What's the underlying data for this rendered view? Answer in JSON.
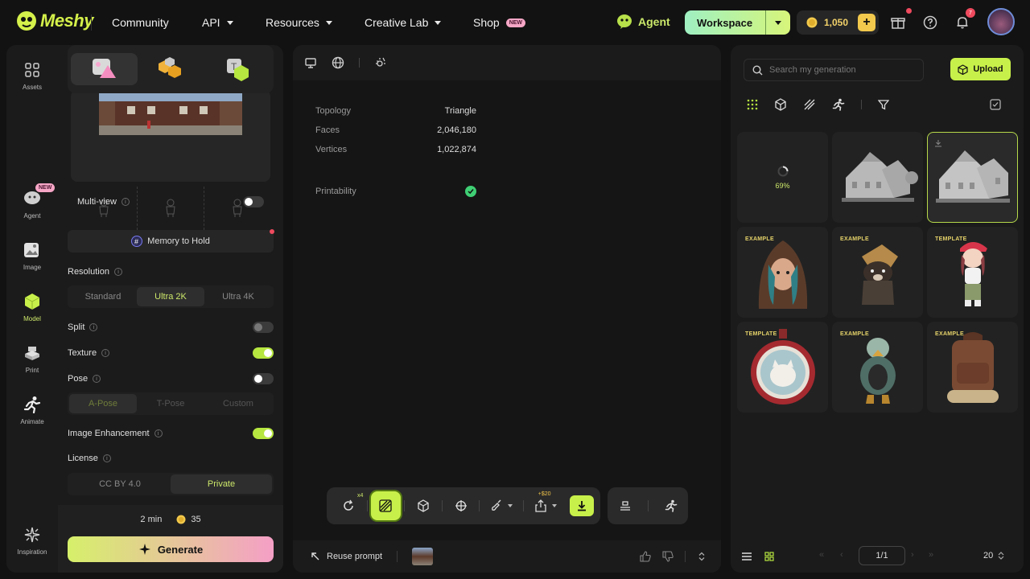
{
  "nav": {
    "logo_text": "Meshy",
    "items": [
      {
        "label": "Community",
        "dropdown": false
      },
      {
        "label": "API",
        "dropdown": true
      },
      {
        "label": "Resources",
        "dropdown": true
      },
      {
        "label": "Creative Lab",
        "dropdown": true
      },
      {
        "label": "Shop",
        "dropdown": false,
        "badge": "NEW"
      }
    ],
    "agent_label": "Agent",
    "workspace_label": "Workspace",
    "credits": "1,050",
    "notification_count": "7"
  },
  "rail": {
    "items": [
      {
        "label": "Assets",
        "icon": "grid-icon"
      },
      {
        "label": "Agent",
        "icon": "chat-bubble-icon",
        "badge": "NEW"
      },
      {
        "label": "Image",
        "icon": "image-plus-icon"
      },
      {
        "label": "Model",
        "icon": "cube-plus-icon",
        "active": true
      },
      {
        "label": "Print",
        "icon": "printer-icon"
      },
      {
        "label": "Animate",
        "icon": "running-figure-icon"
      },
      {
        "label": "Inspiration",
        "icon": "sparkle-icon"
      }
    ]
  },
  "settings": {
    "multiview_label": "Multi-view",
    "memory_label": "Memory to Hold",
    "resolution_label": "Resolution",
    "resolution_options": [
      "Standard",
      "Ultra 2K",
      "Ultra 4K"
    ],
    "resolution_selected": "Ultra 2K",
    "split_label": "Split",
    "texture_label": "Texture",
    "pose_label": "Pose",
    "pose_options": [
      "A-Pose",
      "T-Pose",
      "Custom"
    ],
    "image_enhancement_label": "Image Enhancement",
    "license_label": "License",
    "license_options": [
      "CC BY 4.0",
      "Private"
    ],
    "license_selected": "Private",
    "time_estimate": "2 min",
    "credit_cost": "35",
    "generate_label": "Generate"
  },
  "viewer": {
    "stats": [
      {
        "label": "Topology",
        "value": "Triangle"
      },
      {
        "label": "Faces",
        "value": "2,046,180"
      },
      {
        "label": "Vertices",
        "value": "1,022,874"
      }
    ],
    "printability_label": "Printability",
    "refresh_count": "x4",
    "export_cost": "+$20",
    "reuse_prompt_label": "Reuse prompt"
  },
  "gallery": {
    "search_placeholder": "Search my generation",
    "upload_label": "Upload",
    "progress_text": "69%",
    "cards": [
      {
        "type": "loading"
      },
      {
        "type": "house"
      },
      {
        "type": "house",
        "selected": true
      },
      {
        "tag": "EXAMPLE",
        "subject": "hooded woman"
      },
      {
        "tag": "EXAMPLE",
        "subject": "dog wanderer"
      },
      {
        "tag": "TEMPLATE",
        "subject": "girl in red cap"
      },
      {
        "tag": "TEMPLATE",
        "subject": "cat medallion"
      },
      {
        "tag": "EXAMPLE",
        "subject": "armored bird"
      },
      {
        "tag": "EXAMPLE",
        "subject": "leather backpack"
      }
    ],
    "page": "1/1",
    "page_size": "20"
  },
  "colors": {
    "accent": "#c8f04a",
    "brand_gradient_start": "#d6f06a",
    "brand_gradient_end": "#f59fc6"
  }
}
